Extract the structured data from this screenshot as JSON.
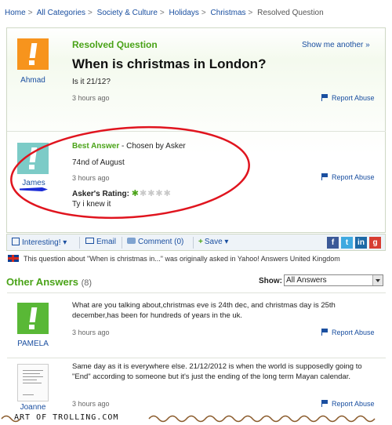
{
  "breadcrumb": [
    "Home",
    "All Categories",
    "Society & Culture",
    "Holidays",
    "Christmas"
  ],
  "breadcrumb_current": "Resolved Question",
  "question": {
    "status": "Resolved Question",
    "show_another": "Show me another »",
    "title": "When is christmas in London?",
    "detail": "Is it 21/12?",
    "time": "3 hours ago",
    "asker": "Ahmad",
    "report": "Report Abuse"
  },
  "best_answer": {
    "heading": "Best Answer",
    "chosen_by": "- Chosen by Asker",
    "text": "74nd of August",
    "time": "3 hours ago",
    "answerer": "James",
    "rating_label": "Asker's Rating:",
    "rating_stars": 1,
    "rating_max": 5,
    "comment": "Ty i knew it",
    "report": "Report Abuse"
  },
  "toolbar": {
    "interesting": "Interesting!",
    "email": "Email",
    "comment": "Comment (0)",
    "save": "Save"
  },
  "origin_note": "This question about \"When is christmas in...\" was originally asked in Yahoo! Answers United Kingdom",
  "other_answers": {
    "title": "Other Answers",
    "count": "(8)",
    "show_label": "Show:",
    "show_value": "All Answers",
    "items": [
      {
        "author": "PAMELA",
        "text": "What are you talking about,christmas eve is 24th dec, and christmas day is 25th december,has been for hundreds of years in the uk.",
        "time": "3 hours ago",
        "report": "Report Abuse"
      },
      {
        "author": "Joanne",
        "text": "Same day as it is everywhere else. 21/12/2012 is when the world is supposedly going to \"End\" according to someone but it's just the ending of the long term Mayan calendar.",
        "time": "3 hours ago",
        "report": "Report Abuse"
      }
    ]
  },
  "watermark": "ART OF TROLLING.COM",
  "colors": {
    "green": "#4aa318",
    "link": "#1a4fa0",
    "highlight_circle": "#e0141e",
    "orange": "#f7941d",
    "teal": "#7ccbc7"
  }
}
